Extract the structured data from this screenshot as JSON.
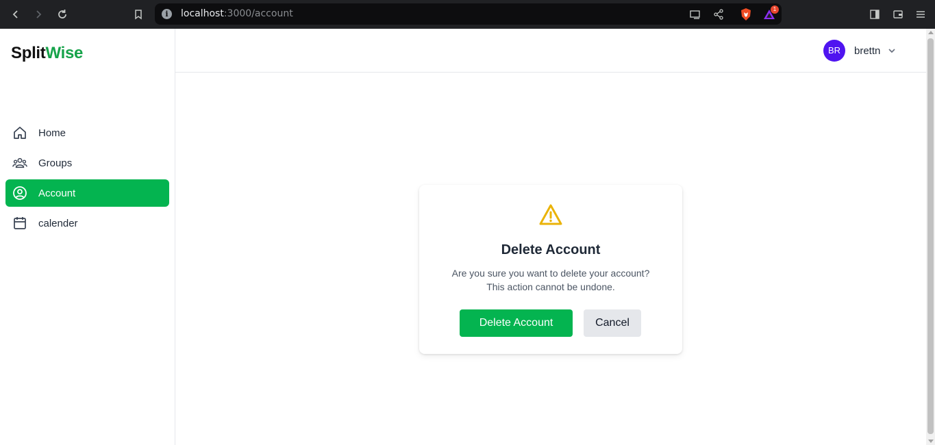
{
  "browser": {
    "url_host": "localhost",
    "url_path": ":3000/account",
    "notification_count": "1"
  },
  "app": {
    "logo_part1": "Split",
    "logo_part2": "Wise",
    "brand_color": "#04b450"
  },
  "sidebar": {
    "items": [
      {
        "label": "Home",
        "icon": "home-icon",
        "active": false
      },
      {
        "label": "Groups",
        "icon": "users-icon",
        "active": false
      },
      {
        "label": "Account",
        "icon": "user-circle-icon",
        "active": true
      },
      {
        "label": "calender",
        "icon": "calendar-icon",
        "active": false
      }
    ]
  },
  "header": {
    "avatar_initials": "BR",
    "username": "brettn"
  },
  "modal": {
    "title": "Delete Account",
    "message_line1": "Are you sure you want to delete your account?",
    "message_line2": "This action cannot be undone.",
    "confirm_label": "Delete Account",
    "cancel_label": "Cancel",
    "warning_color": "#eab308"
  }
}
